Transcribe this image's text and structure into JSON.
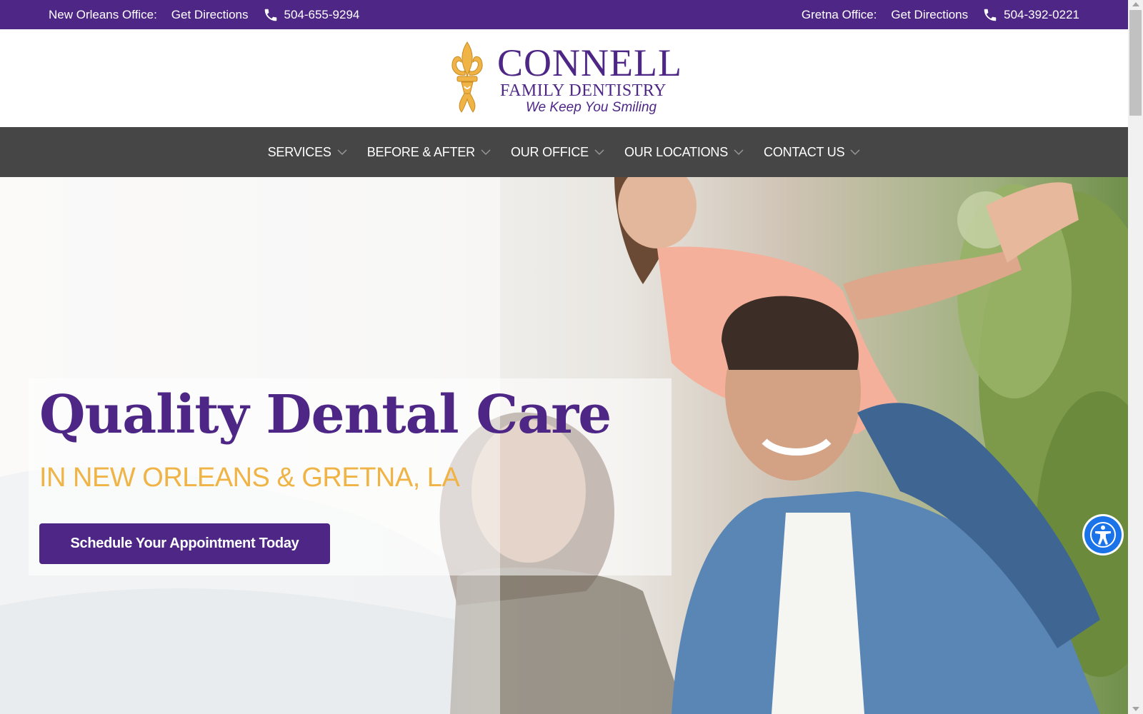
{
  "topbar": {
    "left": {
      "office_label": "New Orleans Office:",
      "directions_label": "Get Directions",
      "phone": "504-655-9294",
      "icon": "phone-icon"
    },
    "right": {
      "office_label": "Gretna Office:",
      "directions_label": "Get Directions",
      "phone": "504-392-0221",
      "icon": "phone-icon"
    }
  },
  "logo": {
    "name": "CONNELL",
    "subtitle": "FAMILY DENTISTRY",
    "tagline": "We Keep You Smiling",
    "icon": "fleur-de-lis-icon"
  },
  "nav": {
    "items": [
      {
        "label": "SERVICES"
      },
      {
        "label": "BEFORE & AFTER"
      },
      {
        "label": "OUR OFFICE"
      },
      {
        "label": "OUR LOCATIONS"
      },
      {
        "label": "CONTACT US"
      }
    ],
    "icon": "chevron-down-icon"
  },
  "hero": {
    "title": "Quality Dental Care",
    "subtitle": "IN NEW ORLEANS & GRETNA, LA",
    "cta_label": "Schedule Your Appointment Today"
  },
  "accessibility": {
    "icon": "accessibility-icon"
  },
  "colors": {
    "brand_purple": "#4e2786",
    "accent_gold": "#f0b345",
    "nav_background": "#464646",
    "accessibility_blue": "#1a73e8"
  }
}
